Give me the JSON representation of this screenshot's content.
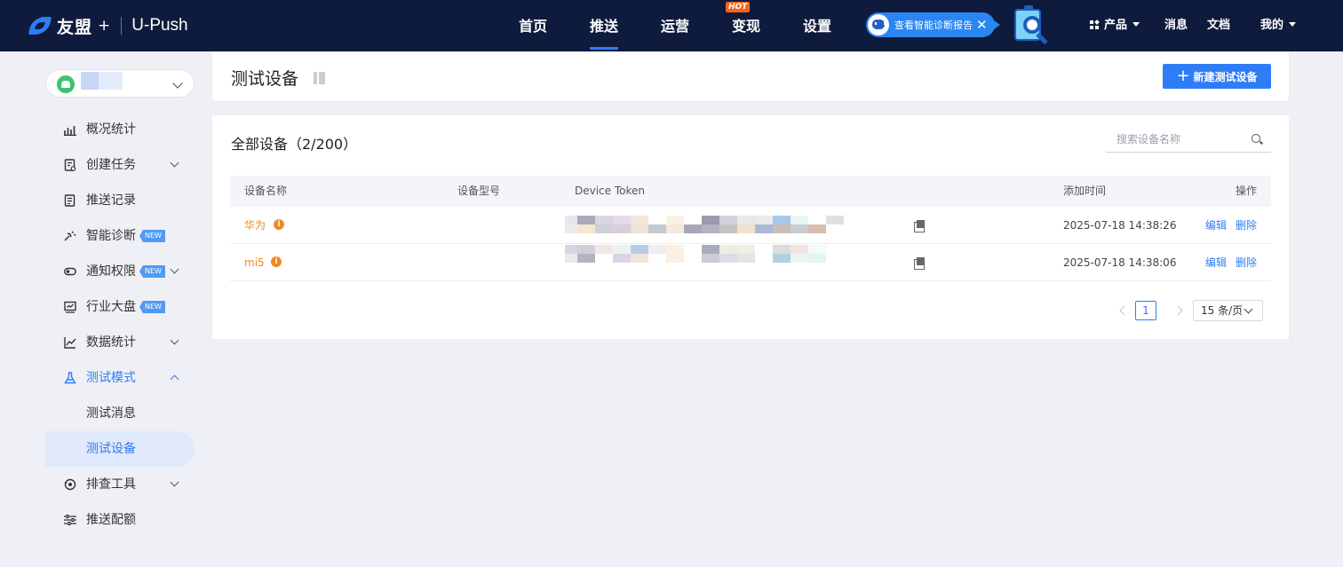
{
  "brand": {
    "name": "友盟",
    "plus": "+",
    "product": "U-Push"
  },
  "nav": {
    "items": [
      {
        "label": "首页",
        "active": false
      },
      {
        "label": "推送",
        "active": true
      },
      {
        "label": "运营",
        "active": false
      },
      {
        "label": "变现",
        "active": false,
        "badge": "HOT"
      },
      {
        "label": "设置",
        "active": false
      }
    ]
  },
  "diagnosis_banner": {
    "text": "查看智能诊断报告",
    "close": "✕"
  },
  "topright": {
    "products": "产品",
    "messages": "消息",
    "docs": "文档",
    "mine": "我的"
  },
  "sidebar": {
    "items": [
      {
        "label": "概况统计",
        "icon": "chart-icon"
      },
      {
        "label": "创建任务",
        "icon": "task-icon",
        "expandable": true
      },
      {
        "label": "推送记录",
        "icon": "record-icon"
      },
      {
        "label": "智能诊断",
        "icon": "diagnosis-icon",
        "badge": "NEW"
      },
      {
        "label": "通知权限",
        "icon": "toggle-icon",
        "badge": "NEW",
        "expandable": true
      },
      {
        "label": "行业大盘",
        "icon": "monitor-icon",
        "badge": "NEW"
      },
      {
        "label": "数据统计",
        "icon": "line-chart-icon",
        "expandable": true
      },
      {
        "label": "测试模式",
        "icon": "flask-icon",
        "expandable": true,
        "expanded": true
      },
      {
        "label": "测试消息",
        "sub": true
      },
      {
        "label": "测试设备",
        "sub": true,
        "selected": true
      },
      {
        "label": "排查工具",
        "icon": "troubleshoot-icon",
        "expandable": true
      },
      {
        "label": "推送配额",
        "icon": "quota-icon"
      }
    ]
  },
  "page": {
    "title": "测试设备",
    "new_button": "新建测试设备",
    "new_button_icon": "+"
  },
  "list": {
    "title": "全部设备（2/200）",
    "search_placeholder": "搜索设备名称",
    "columns": [
      "设备名称",
      "设备型号",
      "Device Token",
      "添加时间",
      "操作"
    ],
    "rows": [
      {
        "name": "华为",
        "model": "",
        "added": "2025-07-18 14:38:26",
        "edit": "编辑",
        "delete": "删除"
      },
      {
        "name": "mi5",
        "model": "",
        "added": "2025-07-18 14:38:06",
        "edit": "编辑",
        "delete": "删除"
      }
    ]
  },
  "pagination": {
    "current": "1",
    "page_size": "15 条/页"
  },
  "colors": {
    "topbar": "#0f1b3d",
    "accent": "#2f7df6",
    "device_name": "#f08a24",
    "badge_hot": "#f5641e",
    "badge_new": "#4e9bf5"
  }
}
